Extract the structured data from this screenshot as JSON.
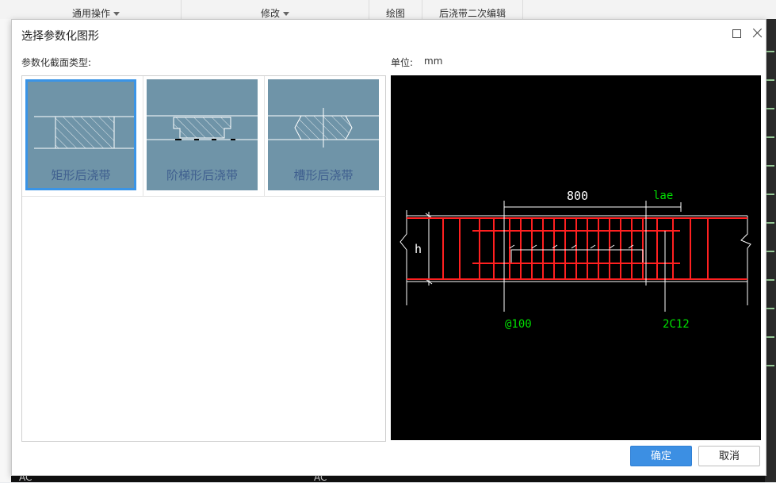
{
  "toolbar": {
    "groups": [
      "通用操作",
      "修改",
      "绘图",
      "后浇带二次编辑"
    ]
  },
  "background": {
    "bottom_labels": [
      "AC",
      "AC"
    ]
  },
  "dialog": {
    "title": "选择参数化图形",
    "section_label": "参数化截面类型:",
    "unit_label": "单位:",
    "unit_value": "mm",
    "options": [
      {
        "label": "矩形后浇带",
        "selected": true
      },
      {
        "label": "阶梯形后浇带",
        "selected": false
      },
      {
        "label": "槽形后浇带",
        "selected": false
      }
    ],
    "preview": {
      "labels": {
        "width": "800",
        "lae": "lae",
        "height": "h",
        "spacing": "@100",
        "bars": "2C12"
      },
      "colors": {
        "rebar": "#ff2020",
        "annotation": "#00e000",
        "outline": "#ffffff"
      }
    },
    "buttons": {
      "ok": "确定",
      "cancel": "取消"
    }
  }
}
